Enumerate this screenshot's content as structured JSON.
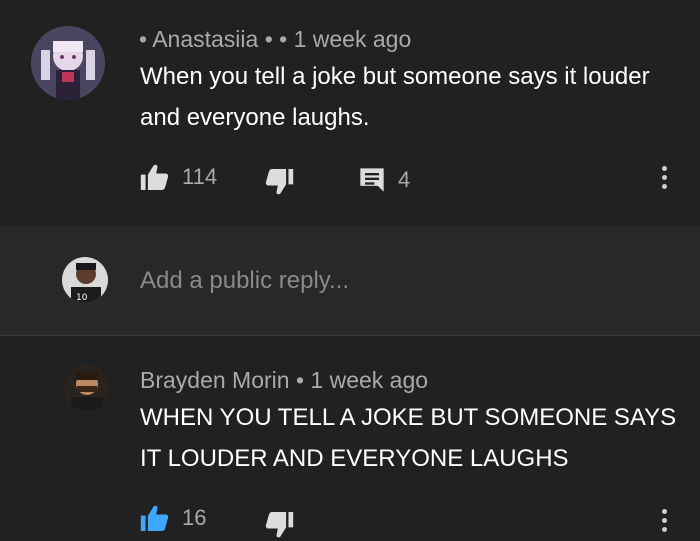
{
  "comments": [
    {
      "author": "Anastasiia",
      "time": "1 week ago",
      "text": "When you tell a joke but someone says it louder and everyone laughs.",
      "likes": "114",
      "replies": "4",
      "liked": false
    },
    {
      "author": "Brayden Morin",
      "time": "1 week ago",
      "text": "WHEN YOU TELL A JOKE BUT SOMEONE SAYS IT LOUDER AND EVERYONE LAUGHS",
      "likes": "16",
      "liked": true
    }
  ],
  "reply_box": {
    "placeholder": "Add a public reply..."
  },
  "icons": {
    "like": "thumb-up-icon",
    "dislike": "thumb-down-icon",
    "reply": "comment-icon",
    "more": "kebab-menu-icon"
  },
  "colors": {
    "background": "#212121",
    "reply_background": "#282828",
    "liked_accent": "#3ea6ff",
    "muted_text": "#aaaaaa"
  }
}
